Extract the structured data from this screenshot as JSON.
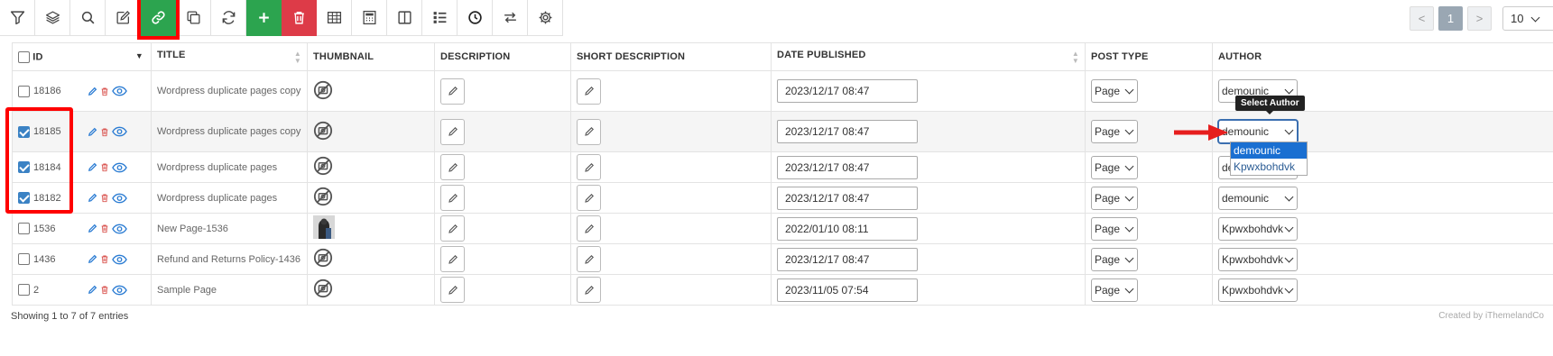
{
  "toolbar": {
    "buttons": [
      {
        "name": "filter-icon"
      },
      {
        "name": "layers-icon"
      },
      {
        "name": "search-icon"
      },
      {
        "name": "edit-icon"
      },
      {
        "name": "link-icon",
        "highlighted": true
      },
      {
        "name": "duplicate-icon"
      },
      {
        "name": "refresh-icon"
      },
      {
        "name": "plus-icon"
      },
      {
        "name": "trash-icon"
      },
      {
        "name": "table-icon"
      },
      {
        "name": "calculator-icon"
      },
      {
        "name": "columns-icon"
      },
      {
        "name": "list-icon"
      },
      {
        "name": "clock-icon"
      },
      {
        "name": "swap-icon"
      },
      {
        "name": "gear-icon"
      }
    ]
  },
  "pagination": {
    "prev": "<",
    "current": "1",
    "next": ">",
    "per_page": "10"
  },
  "table": {
    "headers": {
      "id": "ID",
      "title": "TITLE",
      "thumbnail": "THUMBNAIL",
      "description": "DESCRIPTION",
      "short_description": "SHORT DESCRIPTION",
      "date_published": "DATE PUBLISHED",
      "post_type": "POST TYPE",
      "author": "AUTHOR"
    },
    "rows": [
      {
        "id": "18186",
        "checked": false,
        "title": "Wordpress duplicate pages copy",
        "thumbnail": "placeholder",
        "date": "2023/12/17 08:47",
        "post_type": "Page",
        "author": "demounic"
      },
      {
        "id": "18185",
        "checked": true,
        "title": "Wordpress duplicate pages copy",
        "thumbnail": "placeholder",
        "date": "2023/12/17 08:47",
        "post_type": "Page",
        "author": "demounic"
      },
      {
        "id": "18184",
        "checked": true,
        "title": "Wordpress duplicate pages",
        "thumbnail": "placeholder",
        "date": "2023/12/17 08:47",
        "post_type": "Page",
        "author": "demounic"
      },
      {
        "id": "18182",
        "checked": true,
        "title": "Wordpress duplicate pages",
        "thumbnail": "placeholder",
        "date": "2023/12/17 08:47",
        "post_type": "Page",
        "author": "demounic"
      },
      {
        "id": "1536",
        "checked": false,
        "title": "New Page-1536",
        "thumbnail": "photo",
        "date": "2022/01/10 08:11",
        "post_type": "Page",
        "author": "Kpwxbohdvk"
      },
      {
        "id": "1436",
        "checked": false,
        "title": "Refund and Returns Policy-1436",
        "thumbnail": "placeholder",
        "date": "2023/12/17 08:47",
        "post_type": "Page",
        "author": "Kpwxbohdvk"
      },
      {
        "id": "2",
        "checked": false,
        "title": "Sample Page",
        "thumbnail": "placeholder",
        "date": "2023/11/05 07:54",
        "post_type": "Page",
        "author": "Kpwxbohdvk"
      }
    ]
  },
  "tooltip": "Select Author",
  "author_dropdown": {
    "options": [
      "demounic",
      "Kpwxbohdvk"
    ],
    "selected": "demounic"
  },
  "footer": {
    "showing": "Showing 1 to 7 of 7 entries",
    "credit": "Created by iThemelandCo"
  },
  "colors": {
    "green": "#2ca44f",
    "red": "#dd3b48",
    "highlight": "#ff0000",
    "link_blue": "#2b7cd3"
  }
}
